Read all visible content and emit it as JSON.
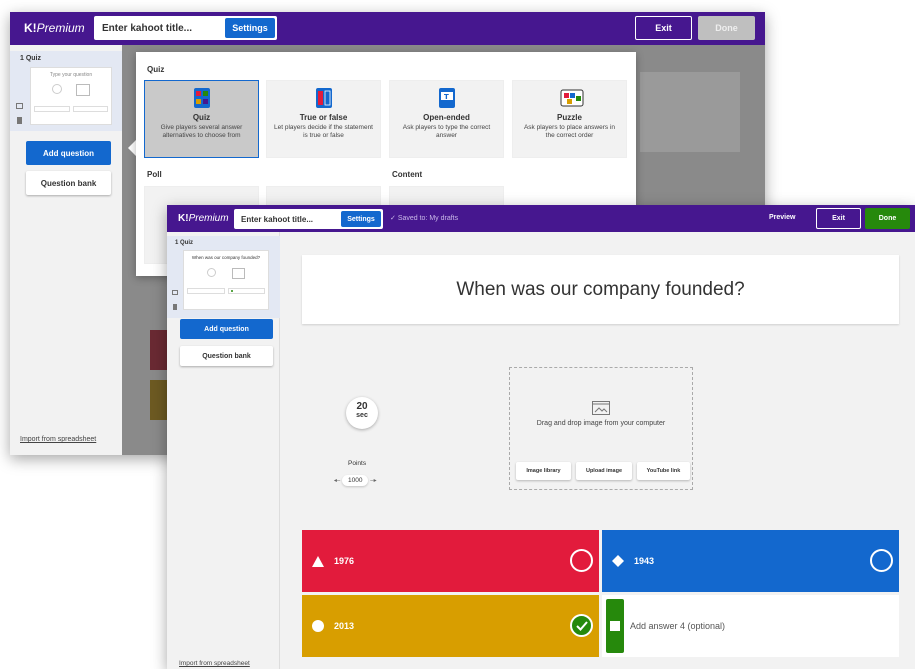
{
  "colors": {
    "purple": "#46178f",
    "blue": "#1368ce",
    "red": "#e21b3c",
    "yellow": "#d89e00",
    "green": "#26890c"
  },
  "back_window": {
    "logo": "K!",
    "logo_premium": "Premium",
    "title_placeholder": "Enter kahoot title...",
    "settings": "Settings",
    "exit": "Exit",
    "done": "Done",
    "sidebar": {
      "quiz_label": "1  Quiz",
      "thumb_placeholder": "Type your question",
      "add_question": "Add question",
      "question_bank": "Question bank",
      "import": "Import from spreadsheet"
    },
    "popup": {
      "quiz_section": "Quiz",
      "poll_section": "Poll",
      "content_section": "Content",
      "types": [
        {
          "name": "Quiz",
          "desc": "Give players several answer alternatives to choose from",
          "icon": "quiz-type-icon"
        },
        {
          "name": "True or false",
          "desc": "Let players decide if the statement is true or false",
          "icon": "true-false-type-icon"
        },
        {
          "name": "Open-ended",
          "desc": "Ask players to type the correct answer",
          "icon": "open-ended-type-icon"
        },
        {
          "name": "Puzzle",
          "desc": "Ask players to place answers in the correct order",
          "icon": "puzzle-type-icon"
        }
      ]
    }
  },
  "front_window": {
    "logo": "K!",
    "logo_premium": "Premium",
    "title_placeholder": "Enter kahoot title...",
    "settings": "Settings",
    "saved_status": "Saved to: My drafts",
    "preview": "Preview",
    "exit": "Exit",
    "done": "Done",
    "sidebar": {
      "quiz_label": "1  Quiz",
      "thumb_question": "When was our company founded?",
      "add_question": "Add question",
      "question_bank": "Question bank",
      "import": "Import from spreadsheet"
    },
    "main": {
      "question": "When was our company founded?",
      "timer_value": "20",
      "timer_unit": "sec",
      "points_label": "Points",
      "points_value": "1000",
      "dropzone_text": "Drag and drop image from your computer",
      "image_library": "Image library",
      "upload_image": "Upload image",
      "youtube_link": "YouTube link"
    },
    "answers": [
      {
        "text": "1976",
        "shape": "triangle-icon",
        "color": "#e21b3c",
        "correct": false
      },
      {
        "text": "1943",
        "shape": "diamond-icon",
        "color": "#1368ce",
        "correct": false
      },
      {
        "text": "2013",
        "shape": "circle-icon",
        "color": "#d89e00",
        "correct": true
      },
      {
        "text": "Add answer 4 (optional)",
        "shape": "square-icon",
        "color": "#26890c",
        "correct": false
      }
    ]
  }
}
